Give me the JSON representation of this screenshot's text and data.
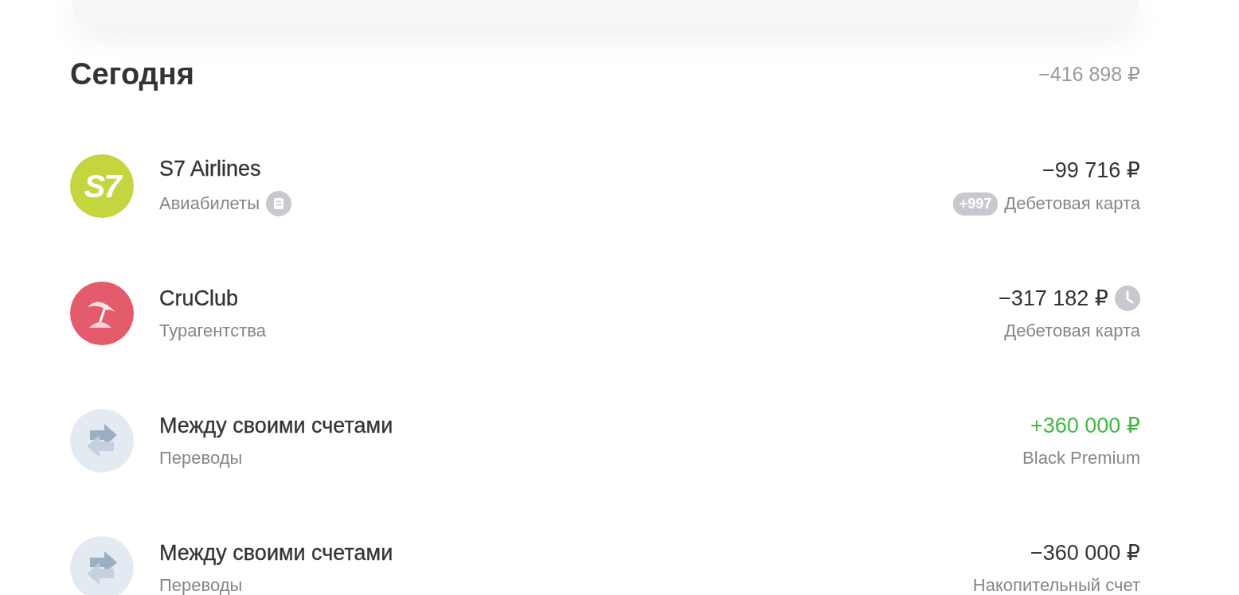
{
  "section": {
    "title": "Сегодня",
    "total": "−416 898 ₽"
  },
  "operations": [
    {
      "kind": "logo",
      "logo_text": "S7",
      "color": "#c5d540",
      "title": "S7 Airlines",
      "category": "Авиабилеты",
      "category_receipt": true,
      "amount": "−99 716 ₽",
      "income": false,
      "pending": false,
      "cashback": "+997",
      "account": "Дебетовая карта"
    },
    {
      "kind": "umbrella",
      "color": "#e45b6b",
      "title": "CruClub",
      "category": "Турагентства",
      "category_receipt": false,
      "amount": "−317 182 ₽",
      "income": false,
      "pending": true,
      "account": "Дебетовая карта"
    },
    {
      "kind": "transfer",
      "color": "#e4eaf2",
      "title": "Между своими счетами",
      "category": "Переводы",
      "category_receipt": false,
      "amount": "+360 000 ₽",
      "income": true,
      "pending": false,
      "account": "Black Premium"
    },
    {
      "kind": "transfer",
      "color": "#e4eaf2",
      "title": "Между своими счетами",
      "category": "Переводы",
      "category_receipt": false,
      "amount": "−360 000 ₽",
      "income": false,
      "pending": false,
      "account": "Накопительный счет"
    }
  ]
}
